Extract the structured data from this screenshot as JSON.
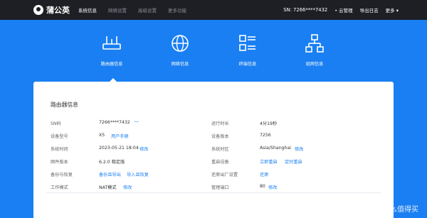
{
  "brand": {
    "name": "蒲公英"
  },
  "nav": {
    "items": [
      "系统信息",
      "网络设置",
      "高级设置",
      "更多功能"
    ]
  },
  "topright": {
    "sn_label": "SN: 7266****7432",
    "cloud": "• 云管理",
    "logs": "导出日志",
    "more": "更多 ▾"
  },
  "tabs": [
    {
      "label": "路由器信息",
      "icon": "router-icon"
    },
    {
      "label": "网络信息",
      "icon": "globe-icon"
    },
    {
      "label": "终端信息",
      "icon": "list-icon"
    },
    {
      "label": "组网信息",
      "icon": "network-icon"
    }
  ],
  "card": {
    "title": "路由器信息",
    "left": [
      {
        "key": "SN码",
        "value": "7266****7432",
        "extra": "︶"
      },
      {
        "key": "设备型号",
        "value": "X5",
        "link": "用户手册"
      },
      {
        "key": "系统时间",
        "value": "2023-05-21 18:04",
        "link": "修改"
      },
      {
        "key": "固件版本",
        "value": "6.2.0 稳定版"
      },
      {
        "key": "备份与恢复",
        "link": "备份且导出",
        "link2": "导入且恢复"
      },
      {
        "key": "工作模式",
        "value": "NAT模式",
        "link": "修改"
      }
    ],
    "right": [
      {
        "key": "运行时长",
        "value": "4分19秒"
      },
      {
        "key": "设备版本",
        "value": "7256"
      },
      {
        "key": "系统时区",
        "value": "Asia/Shanghai",
        "link": "修改"
      },
      {
        "key": "重启设备",
        "link": "立即重启",
        "link2": "定时重启"
      },
      {
        "key": "还原出厂设置",
        "link": "还原"
      },
      {
        "key": "管理端口",
        "value": "80",
        "link": "修改"
      }
    ]
  },
  "watermark": "值 什么值得买",
  "colors": {
    "brand_blue": "#1a7ff2",
    "topbar": "#1e1f24"
  }
}
